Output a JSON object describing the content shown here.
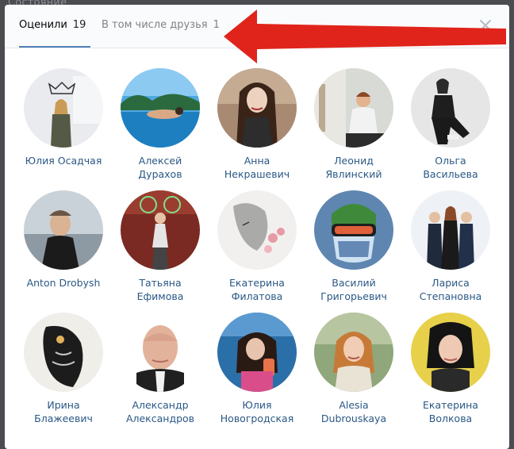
{
  "background": {
    "text": "Состояние"
  },
  "tabs": [
    {
      "label": "Оценили",
      "count": "19"
    },
    {
      "label": "В том числе друзья",
      "count": "1"
    }
  ],
  "colors": {
    "accent": "#5181b8",
    "link": "#2a5885",
    "arrow": "#e0241b"
  },
  "icons": {
    "close": "close-icon",
    "arrow": "red-arrow-annotation"
  },
  "people": [
    {
      "name": "Юлия Осадчая"
    },
    {
      "name": "Алексей\nДурахов"
    },
    {
      "name": "Анна\nНекрашевич"
    },
    {
      "name": "Леонид\nЯвлинский"
    },
    {
      "name": "Ольга\nВасильева"
    },
    {
      "name": "Anton Drobysh"
    },
    {
      "name": "Татьяна\nЕфимова"
    },
    {
      "name": "Екатерина\nФилатова"
    },
    {
      "name": "Василий\nГригорьевич"
    },
    {
      "name": "Лариса\nСтепановна"
    },
    {
      "name": "Ирина\nБлажеевич"
    },
    {
      "name": "Александр\nАлександров"
    },
    {
      "name": "Юлия\nНовогродская"
    },
    {
      "name": "Alesia\nDubrouskaya"
    },
    {
      "name": "Екатерина\nВолкова"
    }
  ]
}
